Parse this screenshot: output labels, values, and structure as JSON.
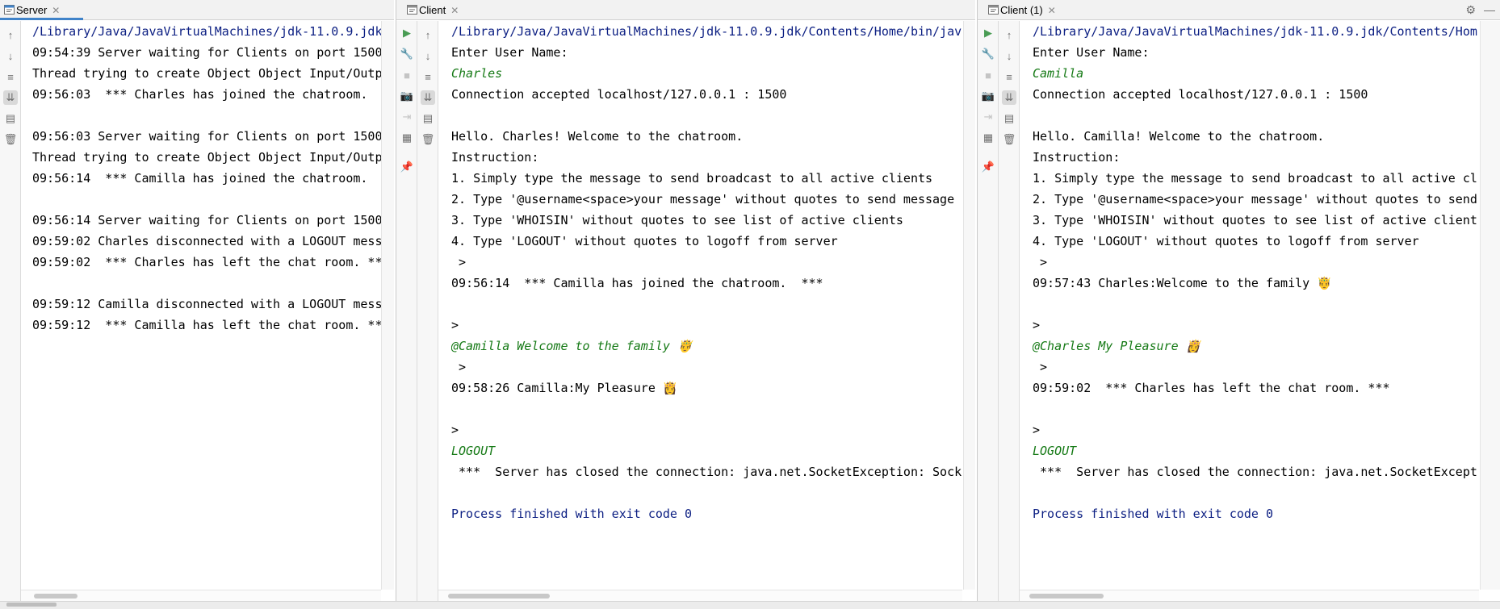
{
  "tabs": {
    "server": "Server",
    "client": "Client",
    "client1": "Client (1)"
  },
  "server_console": [
    {
      "text": "/Library/Java/JavaVirtualMachines/jdk-11.0.9.jdk",
      "kind": "path"
    },
    {
      "text": "09:54:39 Server waiting for Clients on port 1500",
      "kind": "out"
    },
    {
      "text": "Thread trying to create Object Object Input/Outp",
      "kind": "out"
    },
    {
      "text": "09:56:03  *** Charles has joined the chatroom.",
      "kind": "out"
    },
    {
      "text": "",
      "kind": "out"
    },
    {
      "text": "09:56:03 Server waiting for Clients on port 1500",
      "kind": "out"
    },
    {
      "text": "Thread trying to create Object Object Input/Outp",
      "kind": "out"
    },
    {
      "text": "09:56:14  *** Camilla has joined the chatroom.",
      "kind": "out"
    },
    {
      "text": "",
      "kind": "out"
    },
    {
      "text": "09:56:14 Server waiting for Clients on port 1500",
      "kind": "out"
    },
    {
      "text": "09:59:02 Charles disconnected with a LOGOUT mess",
      "kind": "out"
    },
    {
      "text": "09:59:02  *** Charles has left the chat room. **",
      "kind": "out"
    },
    {
      "text": "",
      "kind": "out"
    },
    {
      "text": "09:59:12 Camilla disconnected with a LOGOUT mess",
      "kind": "out"
    },
    {
      "text": "09:59:12  *** Camilla has left the chat room. **",
      "kind": "out"
    }
  ],
  "client_console": [
    {
      "text": "/Library/Java/JavaVirtualMachines/jdk-11.0.9.jdk/Contents/Home/bin/java",
      "kind": "path"
    },
    {
      "text": "Enter User Name:",
      "kind": "out"
    },
    {
      "text": "Charles",
      "kind": "input"
    },
    {
      "text": "Connection accepted localhost/127.0.0.1 : 1500",
      "kind": "out"
    },
    {
      "text": "",
      "kind": "out"
    },
    {
      "text": "Hello. Charles! Welcome to the chatroom.",
      "kind": "out"
    },
    {
      "text": "Instruction:",
      "kind": "out"
    },
    {
      "text": "1. Simply type the message to send broadcast to all active clients",
      "kind": "out"
    },
    {
      "text": "2. Type '@username<space>your message' without quotes to send message t",
      "kind": "out"
    },
    {
      "text": "3. Type 'WHOISIN' without quotes to see list of active clients",
      "kind": "out"
    },
    {
      "text": "4. Type 'LOGOUT' without quotes to logoff from server",
      "kind": "out"
    },
    {
      "text": " >",
      "kind": "out"
    },
    {
      "text": "09:56:14  *** Camilla has joined the chatroom.  ***",
      "kind": "out"
    },
    {
      "text": "",
      "kind": "out"
    },
    {
      "text": ">",
      "kind": "out"
    },
    {
      "text": "@Camilla Welcome to the family 🤴",
      "kind": "input"
    },
    {
      "text": " >",
      "kind": "out"
    },
    {
      "text": "09:58:26 Camilla:My Pleasure 👸",
      "kind": "out"
    },
    {
      "text": "",
      "kind": "out"
    },
    {
      "text": ">",
      "kind": "out"
    },
    {
      "text": "LOGOUT",
      "kind": "input"
    },
    {
      "text": " ***  Server has closed the connection: java.net.SocketException: Socke",
      "kind": "out"
    },
    {
      "text": "",
      "kind": "out"
    },
    {
      "text": "Process finished with exit code 0",
      "kind": "exit"
    }
  ],
  "client1_console": [
    {
      "text": "/Library/Java/JavaVirtualMachines/jdk-11.0.9.jdk/Contents/Hom",
      "kind": "path"
    },
    {
      "text": "Enter User Name:",
      "kind": "out"
    },
    {
      "text": "Camilla",
      "kind": "input"
    },
    {
      "text": "Connection accepted localhost/127.0.0.1 : 1500",
      "kind": "out"
    },
    {
      "text": "",
      "kind": "out"
    },
    {
      "text": "Hello. Camilla! Welcome to the chatroom.",
      "kind": "out"
    },
    {
      "text": "Instruction:",
      "kind": "out"
    },
    {
      "text": "1. Simply type the message to send broadcast to all active cl",
      "kind": "out"
    },
    {
      "text": "2. Type '@username<space>your message' without quotes to send",
      "kind": "out"
    },
    {
      "text": "3. Type 'WHOISIN' without quotes to see list of active client",
      "kind": "out"
    },
    {
      "text": "4. Type 'LOGOUT' without quotes to logoff from server",
      "kind": "out"
    },
    {
      "text": " >",
      "kind": "out"
    },
    {
      "text": "09:57:43 Charles:Welcome to the family 🤴",
      "kind": "out"
    },
    {
      "text": "",
      "kind": "out"
    },
    {
      "text": ">",
      "kind": "out"
    },
    {
      "text": "@Charles My Pleasure 👸",
      "kind": "input"
    },
    {
      "text": " >",
      "kind": "out"
    },
    {
      "text": "09:59:02  *** Charles has left the chat room. ***",
      "kind": "out"
    },
    {
      "text": "",
      "kind": "out"
    },
    {
      "text": ">",
      "kind": "out"
    },
    {
      "text": "LOGOUT",
      "kind": "input"
    },
    {
      "text": " ***  Server has closed the connection: java.net.SocketExcept",
      "kind": "out"
    },
    {
      "text": "",
      "kind": "out"
    },
    {
      "text": "Process finished with exit code 0",
      "kind": "exit"
    }
  ],
  "colors": {
    "path": "#0b1e82",
    "input": "#167a16",
    "output": "#000000",
    "tab_accent": "#4083c9",
    "run_green": "#499c54"
  },
  "icons": {
    "tab": "console-icon",
    "rerun": "run-icon",
    "settings": "wrench-icon",
    "stop": "stop-icon",
    "camera": "camera-icon",
    "restore": "restore-layout-icon",
    "layout": "layout-icon",
    "pin": "pin-icon",
    "up": "arrow-up-icon",
    "down": "arrow-down-icon",
    "wrap": "soft-wrap-icon",
    "scroll": "scroll-to-end-icon",
    "print": "print-icon",
    "trash": "trash-icon",
    "gear": "gear-icon",
    "minimize": "minimize-icon"
  }
}
